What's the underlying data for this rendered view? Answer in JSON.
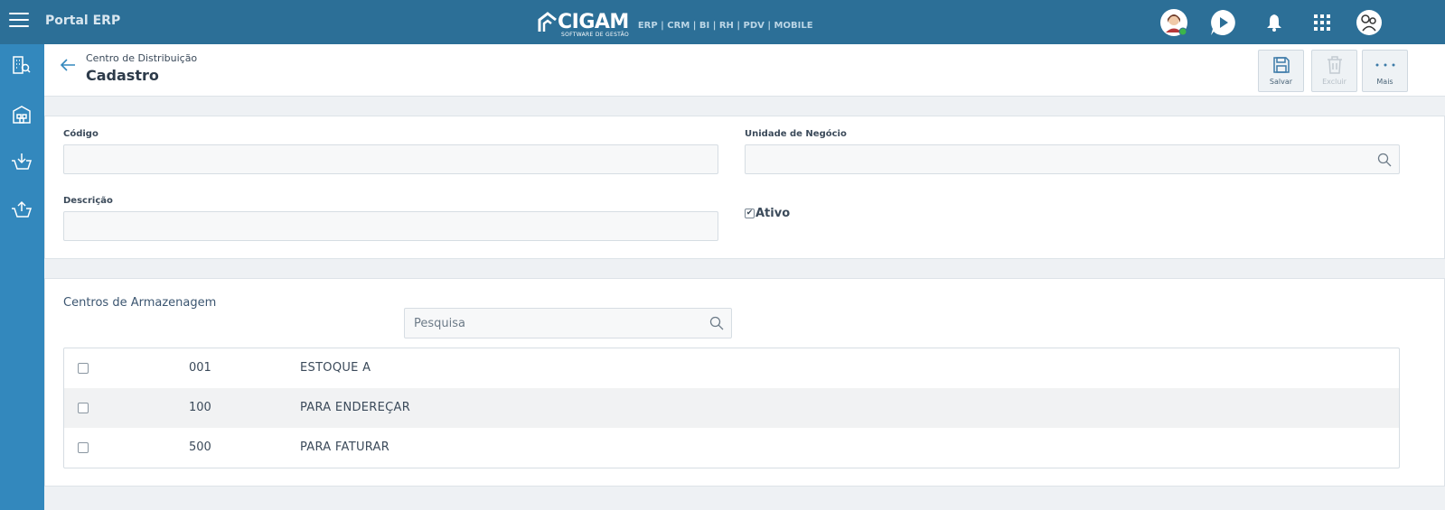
{
  "topbar": {
    "app_title": "Portal ERP",
    "brand": "CIGAM",
    "brand_sub": "SOFTWARE DE GESTÃO",
    "modules": "ERP | CRM | BI | RH | PDV | MOBILE",
    "bg_color": "#2c6f97"
  },
  "sidebar": {
    "bg_color": "#3388bd",
    "items": [
      {
        "icon": "building-search-icon"
      },
      {
        "icon": "warehouse-icon"
      },
      {
        "icon": "basket-in-icon"
      },
      {
        "icon": "basket-out-icon"
      }
    ]
  },
  "header": {
    "breadcrumb": "Centro de Distribuição",
    "title": "Cadastro"
  },
  "toolbar": {
    "save_label": "Salvar",
    "delete_label": "Excluir",
    "more_label": "Mais"
  },
  "form": {
    "codigo_label": "Código",
    "codigo_value": "",
    "unidade_label": "Unidade de Negócio",
    "unidade_value": "",
    "descricao_label": "Descrição",
    "descricao_value": "",
    "ativo_label": "Ativo",
    "ativo_checked": true
  },
  "storage": {
    "title": "Centros de Armazenagem",
    "search_placeholder": "Pesquisa",
    "rows": [
      {
        "code": "001",
        "desc": "ESTOQUE A",
        "checked": false
      },
      {
        "code": "100",
        "desc": "PARA ENDEREÇAR",
        "checked": false
      },
      {
        "code": "500",
        "desc": "PARA FATURAR",
        "checked": false
      }
    ]
  }
}
